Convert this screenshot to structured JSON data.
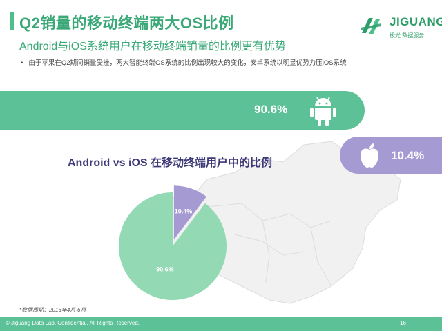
{
  "header": {
    "title": "Q2销量的移动终端两大OS比例",
    "subtitle": "Android与iOS系统用户在移动终端销量的比例更有优势",
    "bullet": "由于苹果在Q2期间销量受挫，两大智能终端OS系统的比例出现较大的变化，安卓系统以明显优势力压iOS系统"
  },
  "logo": {
    "name": "JIGUANG",
    "tagline": "极光 数据服务",
    "icon": "jiguang-logo-icon",
    "color": "#2e9e68"
  },
  "bands": {
    "android": {
      "value_label": "90.6%",
      "icon": "android-icon",
      "color": "#5cc196"
    },
    "ios": {
      "value_label": "10.4%",
      "icon": "apple-icon",
      "color": "#a69ad3"
    }
  },
  "chart_data": {
    "type": "pie",
    "title": "Android vs iOS 在移动终端用户中的比例",
    "slices": [
      {
        "value": 90.6,
        "label": "90.6%",
        "color": "#92d9b4"
      },
      {
        "value": 10.4,
        "label": "10.4%",
        "color": "#a69ad3"
      }
    ]
  },
  "footnote": "*数据周期：2016年4月-6月",
  "footer": {
    "text": "© Jiguang Data Lab. Confidential. All Rights Reserved.",
    "page": "16"
  }
}
